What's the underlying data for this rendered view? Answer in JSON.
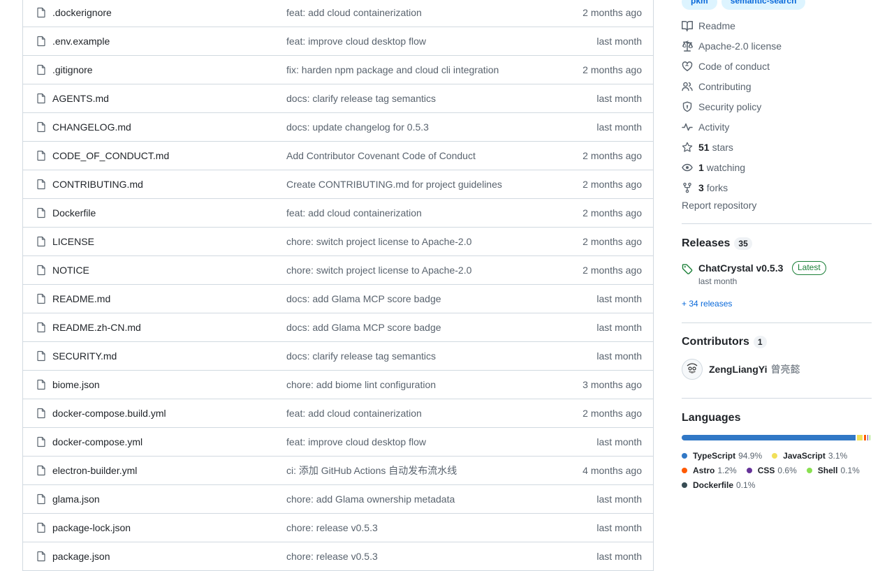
{
  "files": [
    {
      "name": ".dockerignore",
      "message": "feat: add cloud containerization",
      "age": "2 months ago"
    },
    {
      "name": ".env.example",
      "message": "feat: improve cloud desktop flow",
      "age": "last month"
    },
    {
      "name": ".gitignore",
      "message": "fix: harden npm package and cloud cli integration",
      "age": "2 months ago"
    },
    {
      "name": "AGENTS.md",
      "message": "docs: clarify release tag semantics",
      "age": "last month"
    },
    {
      "name": "CHANGELOG.md",
      "message": "docs: update changelog for 0.5.3",
      "age": "last month"
    },
    {
      "name": "CODE_OF_CONDUCT.md",
      "message": "Add Contributor Covenant Code of Conduct",
      "age": "2 months ago"
    },
    {
      "name": "CONTRIBUTING.md",
      "message": "Create CONTRIBUTING.md for project guidelines",
      "age": "2 months ago"
    },
    {
      "name": "Dockerfile",
      "message": "feat: add cloud containerization",
      "age": "2 months ago"
    },
    {
      "name": "LICENSE",
      "message": "chore: switch project license to Apache-2.0",
      "age": "2 months ago"
    },
    {
      "name": "NOTICE",
      "message": "chore: switch project license to Apache-2.0",
      "age": "2 months ago"
    },
    {
      "name": "README.md",
      "message": "docs: add Glama MCP score badge",
      "age": "last month"
    },
    {
      "name": "README.zh-CN.md",
      "message": "docs: add Glama MCP score badge",
      "age": "last month"
    },
    {
      "name": "SECURITY.md",
      "message": "docs: clarify release tag semantics",
      "age": "last month"
    },
    {
      "name": "biome.json",
      "message": "chore: add biome lint configuration",
      "age": "3 months ago"
    },
    {
      "name": "docker-compose.build.yml",
      "message": "feat: add cloud containerization",
      "age": "2 months ago"
    },
    {
      "name": "docker-compose.yml",
      "message": "feat: improve cloud desktop flow",
      "age": "last month"
    },
    {
      "name": "electron-builder.yml",
      "message": "ci: 添加 GitHub Actions 自动发布流水线",
      "age": "4 months ago"
    },
    {
      "name": "glama.json",
      "message": "chore: add Glama ownership metadata",
      "age": "last month"
    },
    {
      "name": "package-lock.json",
      "message": "chore: release v0.5.3",
      "age": "last month"
    },
    {
      "name": "package.json",
      "message": "chore: release v0.5.3",
      "age": "last month"
    }
  ],
  "sidebar": {
    "topics": [
      "pkm",
      "semantic-search"
    ],
    "about_links": [
      {
        "icon": "book-icon",
        "label": "Readme"
      },
      {
        "icon": "law-icon",
        "label": "Apache-2.0 license"
      },
      {
        "icon": "code-of-conduct-icon",
        "label": "Code of conduct"
      },
      {
        "icon": "people-icon",
        "label": "Contributing"
      },
      {
        "icon": "shield-icon",
        "label": "Security policy"
      },
      {
        "icon": "pulse-icon",
        "label": "Activity"
      }
    ],
    "stats": [
      {
        "icon": "star-icon",
        "count": "51",
        "label": "stars"
      },
      {
        "icon": "eye-icon",
        "count": "1",
        "label": "watching"
      },
      {
        "icon": "fork-icon",
        "count": "3",
        "label": "forks"
      }
    ],
    "report": "Report repository",
    "releases": {
      "title": "Releases",
      "count": "35",
      "latest_name": "ChatCrystal v0.5.3",
      "latest_badge": "Latest",
      "latest_date": "last month",
      "more": "+ 34 releases"
    },
    "contributors": {
      "title": "Contributors",
      "count": "1",
      "login": "ZengLiangYi",
      "display_name": "曾亮懿"
    },
    "languages": {
      "title": "Languages",
      "items": [
        {
          "name": "TypeScript",
          "pct_label": "94.9%",
          "pct": 94.9,
          "color": "#3178c6"
        },
        {
          "name": "JavaScript",
          "pct_label": "3.1%",
          "pct": 3.1,
          "color": "#f1e05a"
        },
        {
          "name": "Astro",
          "pct_label": "1.2%",
          "pct": 1.2,
          "color": "#ff5a03"
        },
        {
          "name": "CSS",
          "pct_label": "0.6%",
          "pct": 0.6,
          "color": "#663399"
        },
        {
          "name": "Shell",
          "pct_label": "0.1%",
          "pct": 0.1,
          "color": "#89e051"
        },
        {
          "name": "Dockerfile",
          "pct_label": "0.1%",
          "pct": 0.1,
          "color": "#384d54"
        }
      ]
    }
  }
}
